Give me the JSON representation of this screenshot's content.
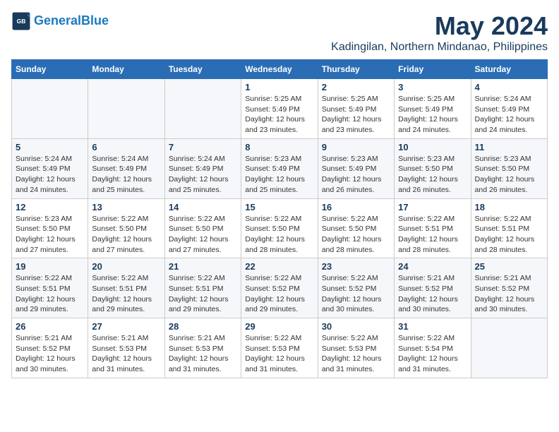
{
  "header": {
    "logo_line1": "General",
    "logo_line2": "Blue",
    "main_title": "May 2024",
    "subtitle": "Kadingilan, Northern Mindanao, Philippines"
  },
  "days_of_week": [
    "Sunday",
    "Monday",
    "Tuesday",
    "Wednesday",
    "Thursday",
    "Friday",
    "Saturday"
  ],
  "weeks": [
    [
      {
        "day": "",
        "info": ""
      },
      {
        "day": "",
        "info": ""
      },
      {
        "day": "",
        "info": ""
      },
      {
        "day": "1",
        "info": "Sunrise: 5:25 AM\nSunset: 5:49 PM\nDaylight: 12 hours\nand 23 minutes."
      },
      {
        "day": "2",
        "info": "Sunrise: 5:25 AM\nSunset: 5:49 PM\nDaylight: 12 hours\nand 23 minutes."
      },
      {
        "day": "3",
        "info": "Sunrise: 5:25 AM\nSunset: 5:49 PM\nDaylight: 12 hours\nand 24 minutes."
      },
      {
        "day": "4",
        "info": "Sunrise: 5:24 AM\nSunset: 5:49 PM\nDaylight: 12 hours\nand 24 minutes."
      }
    ],
    [
      {
        "day": "5",
        "info": "Sunrise: 5:24 AM\nSunset: 5:49 PM\nDaylight: 12 hours\nand 24 minutes."
      },
      {
        "day": "6",
        "info": "Sunrise: 5:24 AM\nSunset: 5:49 PM\nDaylight: 12 hours\nand 25 minutes."
      },
      {
        "day": "7",
        "info": "Sunrise: 5:24 AM\nSunset: 5:49 PM\nDaylight: 12 hours\nand 25 minutes."
      },
      {
        "day": "8",
        "info": "Sunrise: 5:23 AM\nSunset: 5:49 PM\nDaylight: 12 hours\nand 25 minutes."
      },
      {
        "day": "9",
        "info": "Sunrise: 5:23 AM\nSunset: 5:49 PM\nDaylight: 12 hours\nand 26 minutes."
      },
      {
        "day": "10",
        "info": "Sunrise: 5:23 AM\nSunset: 5:50 PM\nDaylight: 12 hours\nand 26 minutes."
      },
      {
        "day": "11",
        "info": "Sunrise: 5:23 AM\nSunset: 5:50 PM\nDaylight: 12 hours\nand 26 minutes."
      }
    ],
    [
      {
        "day": "12",
        "info": "Sunrise: 5:23 AM\nSunset: 5:50 PM\nDaylight: 12 hours\nand 27 minutes."
      },
      {
        "day": "13",
        "info": "Sunrise: 5:22 AM\nSunset: 5:50 PM\nDaylight: 12 hours\nand 27 minutes."
      },
      {
        "day": "14",
        "info": "Sunrise: 5:22 AM\nSunset: 5:50 PM\nDaylight: 12 hours\nand 27 minutes."
      },
      {
        "day": "15",
        "info": "Sunrise: 5:22 AM\nSunset: 5:50 PM\nDaylight: 12 hours\nand 28 minutes."
      },
      {
        "day": "16",
        "info": "Sunrise: 5:22 AM\nSunset: 5:50 PM\nDaylight: 12 hours\nand 28 minutes."
      },
      {
        "day": "17",
        "info": "Sunrise: 5:22 AM\nSunset: 5:51 PM\nDaylight: 12 hours\nand 28 minutes."
      },
      {
        "day": "18",
        "info": "Sunrise: 5:22 AM\nSunset: 5:51 PM\nDaylight: 12 hours\nand 28 minutes."
      }
    ],
    [
      {
        "day": "19",
        "info": "Sunrise: 5:22 AM\nSunset: 5:51 PM\nDaylight: 12 hours\nand 29 minutes."
      },
      {
        "day": "20",
        "info": "Sunrise: 5:22 AM\nSunset: 5:51 PM\nDaylight: 12 hours\nand 29 minutes."
      },
      {
        "day": "21",
        "info": "Sunrise: 5:22 AM\nSunset: 5:51 PM\nDaylight: 12 hours\nand 29 minutes."
      },
      {
        "day": "22",
        "info": "Sunrise: 5:22 AM\nSunset: 5:52 PM\nDaylight: 12 hours\nand 29 minutes."
      },
      {
        "day": "23",
        "info": "Sunrise: 5:22 AM\nSunset: 5:52 PM\nDaylight: 12 hours\nand 30 minutes."
      },
      {
        "day": "24",
        "info": "Sunrise: 5:21 AM\nSunset: 5:52 PM\nDaylight: 12 hours\nand 30 minutes."
      },
      {
        "day": "25",
        "info": "Sunrise: 5:21 AM\nSunset: 5:52 PM\nDaylight: 12 hours\nand 30 minutes."
      }
    ],
    [
      {
        "day": "26",
        "info": "Sunrise: 5:21 AM\nSunset: 5:52 PM\nDaylight: 12 hours\nand 30 minutes."
      },
      {
        "day": "27",
        "info": "Sunrise: 5:21 AM\nSunset: 5:53 PM\nDaylight: 12 hours\nand 31 minutes."
      },
      {
        "day": "28",
        "info": "Sunrise: 5:21 AM\nSunset: 5:53 PM\nDaylight: 12 hours\nand 31 minutes."
      },
      {
        "day": "29",
        "info": "Sunrise: 5:22 AM\nSunset: 5:53 PM\nDaylight: 12 hours\nand 31 minutes."
      },
      {
        "day": "30",
        "info": "Sunrise: 5:22 AM\nSunset: 5:53 PM\nDaylight: 12 hours\nand 31 minutes."
      },
      {
        "day": "31",
        "info": "Sunrise: 5:22 AM\nSunset: 5:54 PM\nDaylight: 12 hours\nand 31 minutes."
      },
      {
        "day": "",
        "info": ""
      }
    ]
  ]
}
